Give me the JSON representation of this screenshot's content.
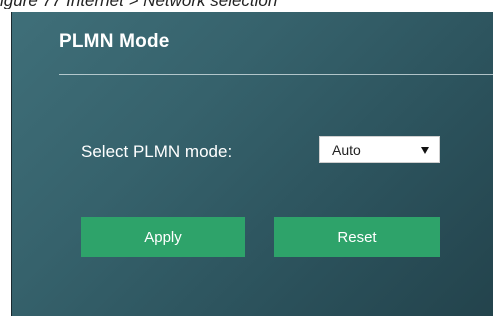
{
  "caption": "igure 77 Internet > Network selection",
  "panel": {
    "title": "PLMN Mode",
    "field_label": "Select PLMN mode:",
    "select": {
      "value": "Auto",
      "arrow_icon": "caret-down-icon"
    },
    "buttons": {
      "apply": "Apply",
      "reset": "Reset"
    },
    "colors": {
      "panel_background": "#36626c",
      "button": "#2ea36a",
      "text": "#ffffff"
    }
  }
}
